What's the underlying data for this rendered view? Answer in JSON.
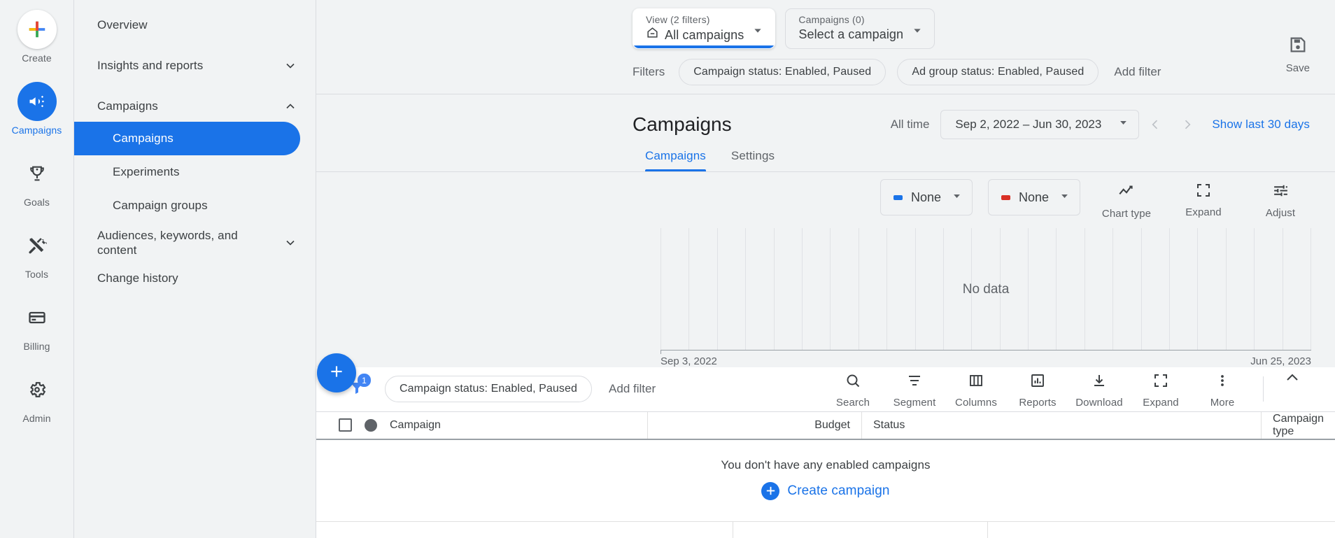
{
  "rail": {
    "items": [
      {
        "label": "Create",
        "icon": "google-plus-icon",
        "active": false
      },
      {
        "label": "Campaigns",
        "icon": "megaphone-icon",
        "active": true
      },
      {
        "label": "Goals",
        "icon": "trophy-icon",
        "active": false
      },
      {
        "label": "Tools",
        "icon": "tools-icon",
        "active": false
      },
      {
        "label": "Billing",
        "icon": "credit-card-icon",
        "active": false
      },
      {
        "label": "Admin",
        "icon": "gear-icon",
        "active": false
      }
    ]
  },
  "nav": {
    "overview": "Overview",
    "insights": "Insights and reports",
    "campaigns": "Campaigns",
    "sub_campaigns": "Campaigns",
    "sub_experiments": "Experiments",
    "sub_campaign_groups": "Campaign groups",
    "audiences": "Audiences, keywords, and content",
    "change_history": "Change history"
  },
  "topbar": {
    "view_selector": {
      "caption": "View (2 filters)",
      "value": "All campaigns",
      "icon": "home-icon"
    },
    "campaign_selector": {
      "caption": "Campaigns (0)",
      "value": "Select a campaign"
    },
    "filters_label": "Filters",
    "chips": [
      "Campaign status: Enabled, Paused",
      "Ad group status: Enabled, Paused"
    ],
    "add_filter": "Add filter",
    "save": {
      "label": "Save",
      "icon": "save-floppy-icon"
    }
  },
  "pagehead": {
    "title": "Campaigns",
    "all_time": "All time",
    "date_range": "Sep 2, 2022 – Jun 30, 2023",
    "show_last_30": "Show last 30 days"
  },
  "tabs": [
    {
      "label": "Campaigns",
      "active": true
    },
    {
      "label": "Settings",
      "active": false
    }
  ],
  "chart_controls": {
    "metric_left": {
      "value": "None",
      "color": "#1a73e8"
    },
    "metric_right": {
      "value": "None",
      "color": "#d93025"
    },
    "buttons": [
      {
        "label": "Chart type",
        "icon": "line-chart-icon"
      },
      {
        "label": "Expand",
        "icon": "expand-icon"
      },
      {
        "label": "Adjust",
        "icon": "tune-sliders-icon"
      }
    ]
  },
  "chart_data": {
    "type": "line",
    "title": "",
    "no_data_text": "No data",
    "series": [
      {
        "name": "None",
        "color": "#1a73e8",
        "values": []
      },
      {
        "name": "None",
        "color": "#d93025",
        "values": []
      }
    ],
    "x": [],
    "xlabel": "",
    "ylabel": "",
    "x_axis_start": "Sep 3, 2022",
    "x_axis_end": "Jun 25, 2023",
    "gridlines": 24,
    "grid": true,
    "legend": "top-right"
  },
  "fab": {
    "icon": "plus-icon",
    "label": ""
  },
  "table_toolbar": {
    "filter_badge": "1",
    "filter_icon": "funnel-icon",
    "chip": "Campaign status: Enabled, Paused",
    "add_filter": "Add filter",
    "icons": [
      {
        "label": "Search",
        "icon": "search-icon"
      },
      {
        "label": "Segment",
        "icon": "segment-icon"
      },
      {
        "label": "Columns",
        "icon": "columns-icon"
      },
      {
        "label": "Reports",
        "icon": "bar-chart-icon"
      },
      {
        "label": "Download",
        "icon": "download-icon"
      },
      {
        "label": "Expand",
        "icon": "expand-icon"
      },
      {
        "label": "More",
        "icon": "more-vert-icon"
      }
    ],
    "collapse_icon": "chevron-up-icon"
  },
  "table": {
    "columns": [
      "Campaign",
      "Budget",
      "Status",
      "Campaign type"
    ],
    "rows": [],
    "empty_message": "You don't have any enabled campaigns",
    "create_campaign": "Create campaign"
  }
}
